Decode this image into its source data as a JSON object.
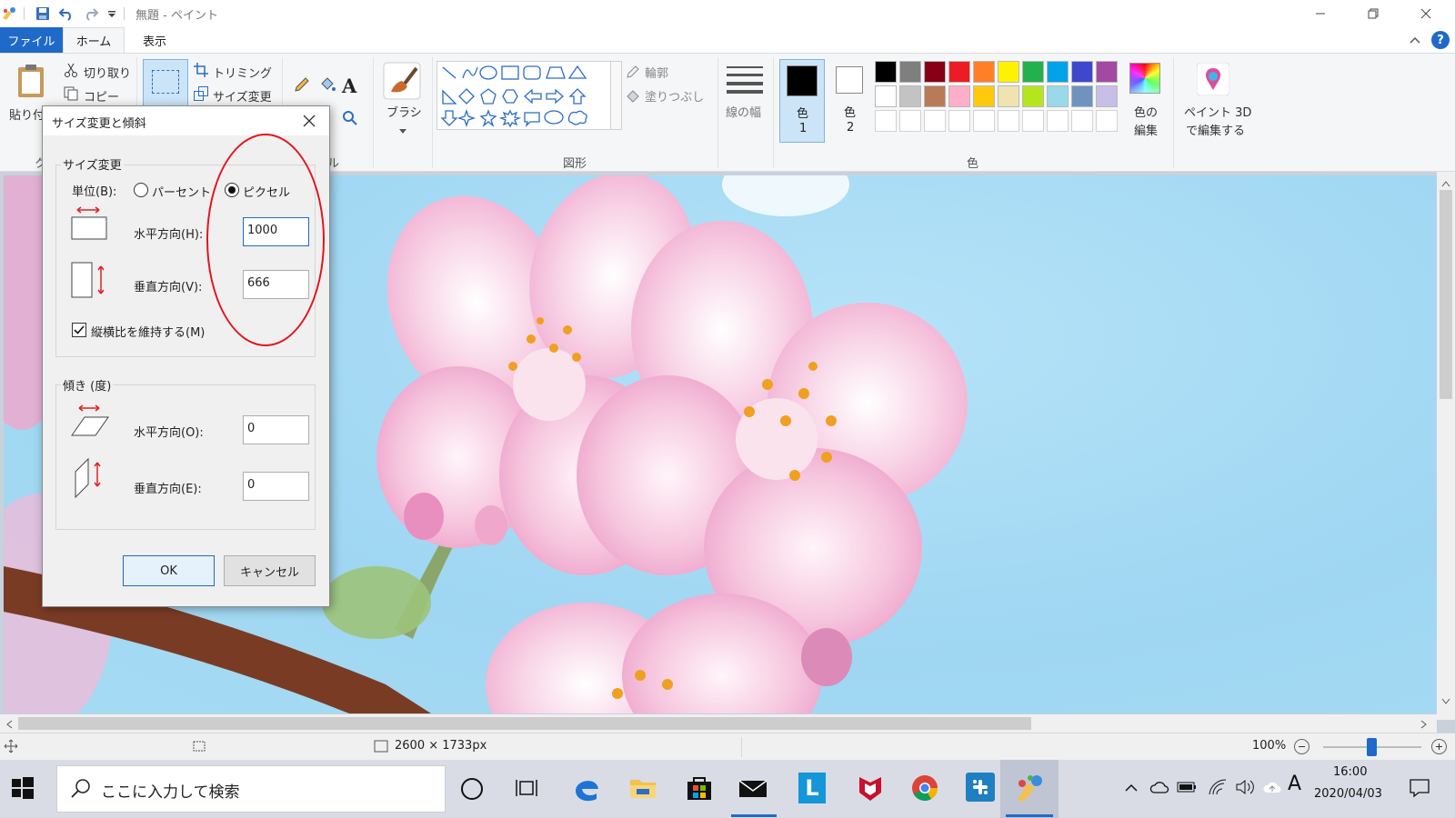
{
  "window": {
    "title": "無題 - ペイント"
  },
  "tabs": {
    "file": "ファイル",
    "home": "ホーム",
    "view": "表示"
  },
  "ribbon": {
    "paste": "貼り付",
    "cut": "切り取り",
    "copy": "コピー",
    "crop": "トリミング",
    "resize": "サイズ変更",
    "brushes": "ブラシ",
    "outline": "輪郭",
    "fill": "塗りつぶし",
    "size": "線の幅",
    "color1_line1": "色",
    "color1_line2": "1",
    "color2_line1": "色",
    "color2_line2": "2",
    "edit_colors_line1": "色の",
    "edit_colors_line2": "編集",
    "paint3d_line1": "ペイント 3D",
    "paint3d_line2": "で編集する",
    "group_clipboard_partial": "ク",
    "group_tools_partial": "ル",
    "group_shapes": "図形",
    "group_colors": "色"
  },
  "palette": {
    "row1": [
      "#000000",
      "#7f7f7f",
      "#880015",
      "#ed1c24",
      "#ff7f27",
      "#fff200",
      "#22b14c",
      "#00a2e8",
      "#3f48cc",
      "#a349a4"
    ],
    "row2": [
      "#ffffff",
      "#c3c3c3",
      "#b97a57",
      "#ffaec9",
      "#ffc90e",
      "#efe4b0",
      "#b5e61d",
      "#99d9ea",
      "#7092be",
      "#c8bfe7"
    ],
    "row3": [
      "#ffffff",
      "#ffffff",
      "#ffffff",
      "#ffffff",
      "#ffffff",
      "#ffffff",
      "#ffffff",
      "#ffffff",
      "#ffffff",
      "#ffffff"
    ],
    "color1": "#000000",
    "color2": "#ffffff"
  },
  "dialog": {
    "title": "サイズ変更と傾斜",
    "resize_legend": "サイズ変更",
    "unit_label": "単位(B):",
    "percent": "パーセント",
    "pixels": "ピクセル",
    "horizontal_label": "水平方向(H):",
    "horizontal_value": "1000",
    "vertical_label": "垂直方向(V):",
    "vertical_value": "666",
    "aspect_label": "縦横比を維持する(M)",
    "skew_legend": "傾き (度)",
    "skew_h_label": "水平方向(O):",
    "skew_h_value": "0",
    "skew_v_label": "垂直方向(E):",
    "skew_v_value": "0",
    "ok": "OK",
    "cancel": "キャンセル"
  },
  "status": {
    "image_size": "2600 × 1733px",
    "zoom": "100%"
  },
  "taskbar": {
    "search_placeholder": "ここに入力して検索",
    "time": "16:00",
    "date": "2020/04/03",
    "ime": "A"
  }
}
